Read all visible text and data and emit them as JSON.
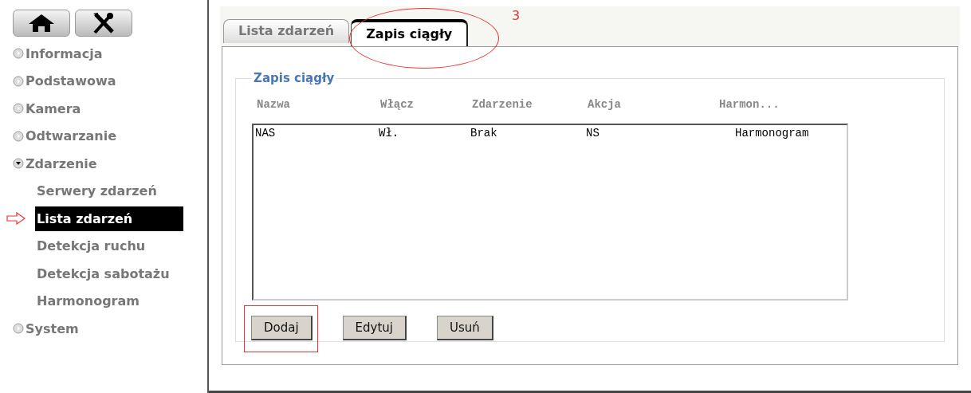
{
  "sidebar": {
    "items": [
      {
        "label": "Informacja",
        "expanded": false
      },
      {
        "label": "Podstawowa",
        "expanded": false
      },
      {
        "label": "Kamera",
        "expanded": false
      },
      {
        "label": "Odtwarzanie",
        "expanded": false
      },
      {
        "label": "Zdarzenie",
        "expanded": true,
        "children": [
          {
            "label": "Serwery zdarzeń",
            "selected": false
          },
          {
            "label": "Lista zdarzeń",
            "selected": true
          },
          {
            "label": "Detekcja ruchu",
            "selected": false
          },
          {
            "label": "Detekcja sabotażu",
            "selected": false
          },
          {
            "label": "Harmonogram",
            "selected": false
          }
        ]
      },
      {
        "label": "System",
        "expanded": false
      }
    ]
  },
  "tabs": [
    {
      "label": "Lista zdarzeń",
      "selected": false
    },
    {
      "label": "Zapis ciągły",
      "selected": true
    }
  ],
  "annotation": {
    "label": "3"
  },
  "group": {
    "title": "Zapis ciągły",
    "table": {
      "columns": [
        "Nazwa",
        "Włącz",
        "Zdarzenie",
        "Akcja",
        "Harmon..."
      ],
      "rows": [
        [
          "NAS",
          "Wł.",
          "Brak",
          "NS",
          "Harmonogram"
        ]
      ]
    }
  },
  "buttons": [
    {
      "label": "Dodaj",
      "highlighted": true
    },
    {
      "label": "Edytuj",
      "highlighted": false
    },
    {
      "label": "Usuń",
      "highlighted": false
    }
  ]
}
